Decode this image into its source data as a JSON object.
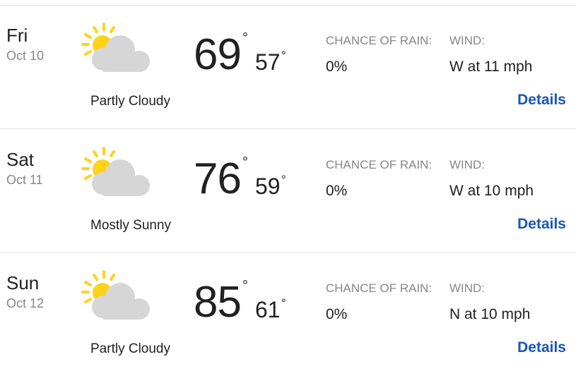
{
  "forecast": {
    "labels": {
      "chance_of_rain": "CHANCE OF RAIN:",
      "wind": "WIND:",
      "details": "Details",
      "degree": "°"
    },
    "colors": {
      "text": "#212121",
      "muted": "#878787",
      "link": "#1a56b6",
      "sun": "#ffd31a",
      "cloud": "#d6d6d6"
    },
    "days": [
      {
        "day": "Fri",
        "date": "Oct 10",
        "icon": "partly-cloudy-icon",
        "condition": "Partly Cloudy",
        "high": "69",
        "low": "57",
        "rain": "0%",
        "wind": "W at 11 mph"
      },
      {
        "day": "Sat",
        "date": "Oct 11",
        "icon": "partly-cloudy-icon",
        "condition": "Mostly Sunny",
        "high": "76",
        "low": "59",
        "rain": "0%",
        "wind": "W at 10 mph"
      },
      {
        "day": "Sun",
        "date": "Oct 12",
        "icon": "partly-cloudy-icon",
        "condition": "Partly Cloudy",
        "high": "85",
        "low": "61",
        "rain": "0%",
        "wind": "N at 10 mph"
      }
    ]
  }
}
